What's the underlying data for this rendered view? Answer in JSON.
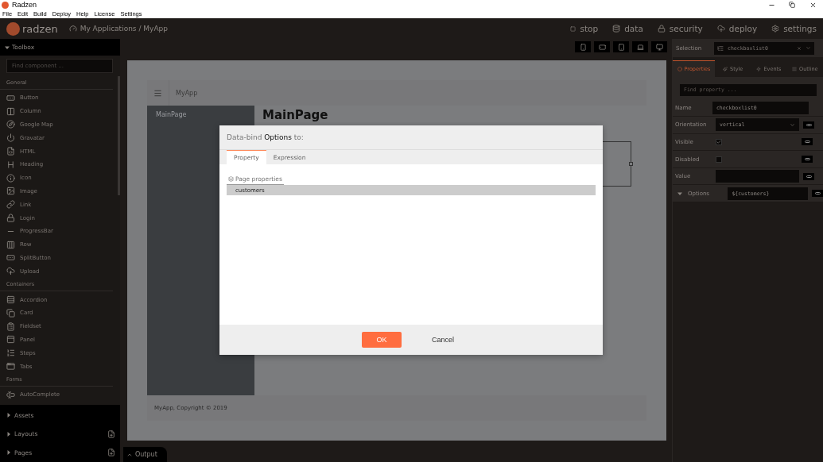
{
  "window": {
    "title": "Radzen"
  },
  "menu": [
    "File",
    "Edit",
    "Build",
    "Deploy",
    "Help",
    "License",
    "Settings"
  ],
  "app_bar": {
    "logo": "radzen",
    "breadcrumb": "My Applications / MyApp",
    "actions": [
      "stop",
      "data",
      "security",
      "deploy",
      "settings"
    ]
  },
  "toolbox": {
    "title": "Toolbox",
    "expanded": true,
    "search": {
      "placeholder": "Find component ..."
    },
    "sections": [
      {
        "title": "General",
        "items": [
          "Button",
          "Column",
          "Google Map",
          "Gravatar",
          "HTML",
          "Heading",
          "Icon",
          "Image",
          "Link",
          "Login",
          "ProgressBar",
          "Row",
          "SplitButton",
          "Upload"
        ]
      },
      {
        "title": "Containers",
        "items": [
          "Accordion",
          "Card",
          "Fieldset",
          "Panel",
          "Steps",
          "Tabs"
        ]
      },
      {
        "title": "Forms",
        "items": [
          "AutoComplete"
        ]
      }
    ]
  },
  "bottom_panels": [
    {
      "label": "Assets",
      "expanded": false,
      "add": false
    },
    {
      "label": "Layouts",
      "expanded": false,
      "add": true
    },
    {
      "label": "Pages",
      "expanded": false,
      "add": true
    }
  ],
  "devices": [
    {
      "selected": false
    },
    {
      "selected": false
    },
    {
      "selected": false
    },
    {
      "selected": false
    },
    {
      "selected": false
    }
  ],
  "canvas": {
    "app_title": "MyApp",
    "nav_items": [
      "MainPage"
    ],
    "heading": "MainPage",
    "footer": "MyApp, Copyright © 2019"
  },
  "dialog": {
    "title": "Data-bind **Options** to:",
    "tabs": [
      {
        "label": "Property",
        "selected": true
      },
      {
        "label": "Expression",
        "selected": false
      }
    ],
    "tree_title": "Page properties",
    "items": [
      {
        "label": "customers",
        "selected": true
      }
    ],
    "buttons": {
      "ok": "OK",
      "cancel": "Cancel"
    }
  },
  "output_tab": {
    "label": "Output"
  },
  "properties": {
    "selection_label": "Selection",
    "selection": "checkboxlist0",
    "tabs": [
      {
        "label": "Properties",
        "selected": true
      },
      {
        "label": "Style",
        "selected": false
      },
      {
        "label": "Events",
        "selected": false
      },
      {
        "label": "Outline",
        "selected": false
      }
    ],
    "search": {
      "placeholder": "Find property ..."
    },
    "rows": [
      {
        "kind": "text",
        "label": "Name",
        "value": "checkboxlist0",
        "bindable": false
      },
      {
        "kind": "select",
        "label": "Orientation",
        "value": "vertical",
        "bindable": true
      },
      {
        "kind": "checkbox",
        "label": "Visible",
        "checked": true,
        "bindable": true
      },
      {
        "kind": "checkbox",
        "label": "Disabled",
        "checked": false,
        "bindable": true
      },
      {
        "kind": "text",
        "label": "Value",
        "value": "",
        "bindable": true
      },
      {
        "kind": "group",
        "label": "Options",
        "value": "${customers}",
        "bindable": true
      }
    ]
  }
}
